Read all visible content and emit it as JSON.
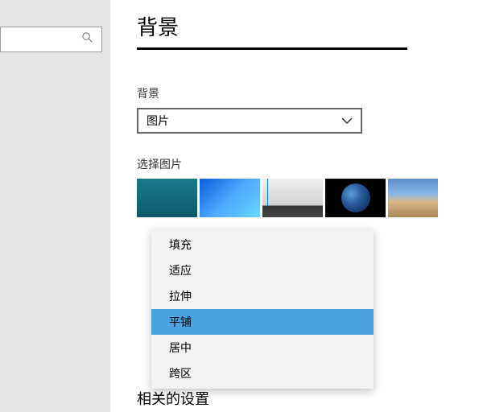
{
  "sidebar": {
    "search_placeholder": ""
  },
  "page": {
    "title": "背景"
  },
  "background_section": {
    "label": "背景",
    "selected": "图片"
  },
  "choose_picture": {
    "label": "选择图片"
  },
  "fit_menu": {
    "items": [
      {
        "label": "填充"
      },
      {
        "label": "适应"
      },
      {
        "label": "拉伸"
      },
      {
        "label": "平铺"
      },
      {
        "label": "居中"
      },
      {
        "label": "跨区"
      }
    ],
    "selected_index": 3
  },
  "related": {
    "label": "相关的设置"
  }
}
